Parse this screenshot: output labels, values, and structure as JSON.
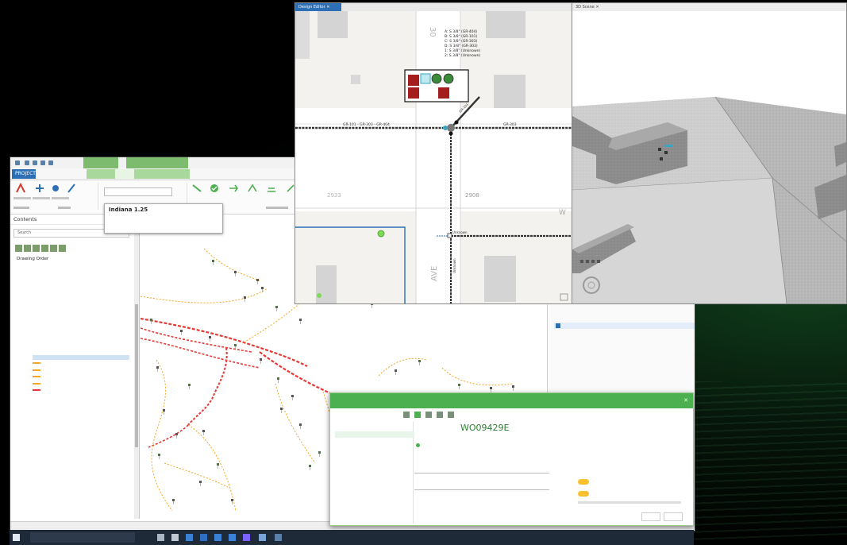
{
  "colors": {
    "accent_green": "#4caf50",
    "ribbon_blue": "#2c6fb5",
    "electric_red": "#e53935",
    "electric_orange": "#f5a623",
    "taskbar": "#1f2a38"
  },
  "pro": {
    "tabs": [
      "PROJECT",
      "",
      "",
      "",
      "",
      "",
      ""
    ],
    "contents_title": "Contents",
    "search_placeholder": "Search",
    "drawing_order": "Drawing Order",
    "toc_rows": [
      "",
      "",
      "",
      "",
      "",
      "",
      "",
      "",
      "",
      "",
      "",
      "",
      "",
      "",
      "",
      "",
      "",
      "",
      "",
      "",
      "",
      "",
      "",
      "",
      "",
      "",
      "",
      "",
      "",
      "",
      "",
      "",
      "",
      "",
      ""
    ],
    "popup": {
      "title": "Indiana 1.25",
      "subtitle": "",
      "body": "",
      "link": ""
    },
    "status_text": "",
    "right_pane": {
      "header": "",
      "item": ""
    }
  },
  "design_editor": {
    "tab_label": "Design Editor",
    "labels": {
      "a": "A: S 3/8\" (GR-404)",
      "b": "B: S 3/8\" (GR-101)",
      "c": "C: S 3/8\" (GR-303)",
      "d": "D: S 3/8\" (GR-303)",
      "one": "1: S 3/8\" (Unknown)",
      "two": "2: S 3/8\" (Unknown)"
    },
    "street_num_top": "30",
    "street_num_lower": "1",
    "wire_left": "GR-101 - GR-303 - GR-404",
    "wire_right": "GR-303",
    "wire_diag": "GR-101",
    "parcel_left": "2933",
    "parcel_right": "2908",
    "street_ave": "AVE",
    "street_w": "W",
    "unknown_label": "Unknown",
    "unknown_vertical": "Unknown"
  },
  "scene": {
    "tab_label": "3D Scene"
  },
  "work_manager": {
    "title": "",
    "toolbar_label": "",
    "tab_mine": "",
    "tab_all": "",
    "list_item": "",
    "work_order": "WO09429E",
    "work_order_sub": "",
    "status_line": "",
    "field1_label": "",
    "field1_value": "",
    "field2_label": "",
    "field2_value": "",
    "expand_label": "",
    "count": "",
    "activity_header": "",
    "activity_1": "",
    "activity_2": "",
    "btn1": "",
    "btn2": ""
  },
  "taskbar": {
    "search_placeholder": "",
    "time": "",
    "date": ""
  }
}
